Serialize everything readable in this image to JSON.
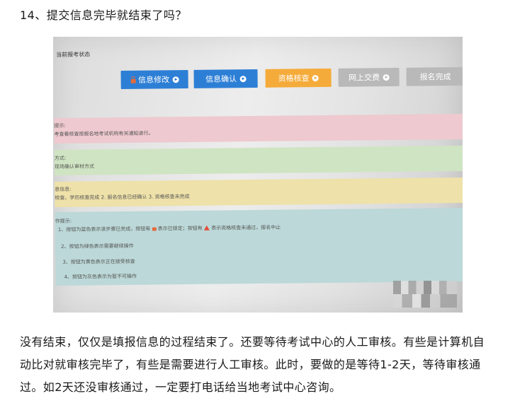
{
  "heading": "14、提交信息完毕就结束了吗？",
  "screenshot": {
    "status_title": "当前报考状态",
    "steps": [
      {
        "label": "信息修改",
        "state": "completed",
        "color": "#2d7fd6",
        "lock_icon": "lock-icon"
      },
      {
        "label": "信息确认",
        "state": "completed",
        "color": "#2d7fd6"
      },
      {
        "label": "资格核查",
        "state": "in-review",
        "color": "#f5ab3a"
      },
      {
        "label": "网上交费",
        "state": "disabled",
        "color": "#b9b9b9"
      },
      {
        "label": "报名完成",
        "state": "disabled",
        "color": "#b9b9b9"
      }
    ],
    "bands": {
      "prompt_label": "提示:",
      "prompt_text": "考查看核查按报名地考试机构有关通知进行。",
      "method_label": "方式:",
      "method_text": "现场确认审材方式",
      "info_label": "息信息:",
      "info_text": "核查、学历核查完成 2. 报名信息已经确认 3. 资格核查未完成",
      "ops_label": "作提示:",
      "ops_lines": [
        "1、按钮为蓝色表示该步骤已完成，按钮有",
        "表示已锁定；按钮有",
        "表示资格核查未通过，报名中止",
        "2、按钮为绿色表示需要继续操作",
        "3、按钮为黄色表示正在接受核查",
        "4、按钮为灰色表示为暂不可操作"
      ]
    }
  },
  "paragraph": "没有结束，仅仅是填报信息的过程结束了。还要等待考试中心的人工审核。有些是计算机自动比对就审核完毕了，有些是需要进行人工审核。此时，要做的是等待1-2天，等待审核通过。如2天还没审核通过，一定要打电话给当地考试中心咨询。"
}
